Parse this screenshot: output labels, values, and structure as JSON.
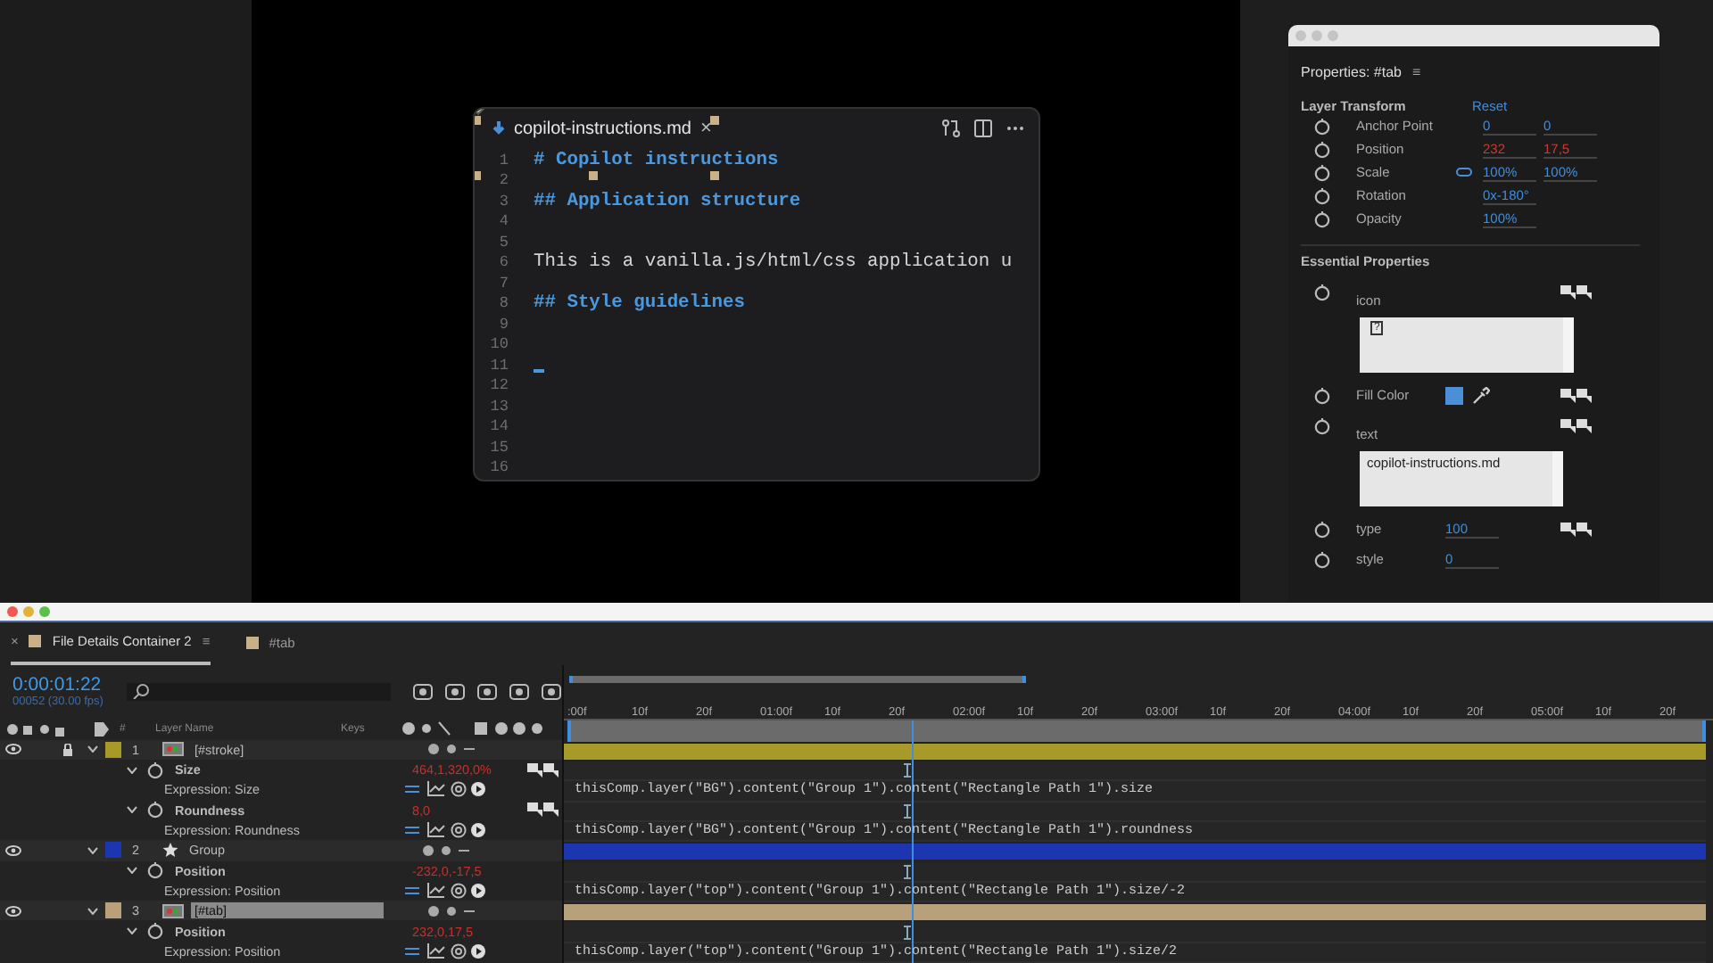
{
  "editor": {
    "tab_title": "copilot-instructions.md",
    "close": "×",
    "lines": [
      {
        "number": "1",
        "text": "# Copilot instructions",
        "kind": "heading"
      },
      {
        "number": "2",
        "kind": "empty"
      },
      {
        "number": "3",
        "text": "## Application structure",
        "kind": "heading"
      },
      {
        "number": "4",
        "kind": "empty"
      },
      {
        "number": "5",
        "kind": "empty"
      },
      {
        "number": "6",
        "text": "This is a vanilla.js/html/css application u",
        "kind": "plain"
      },
      {
        "number": "7",
        "kind": "empty"
      },
      {
        "number": "8",
        "text": "## Style guidelines",
        "kind": "heading"
      },
      {
        "number": "9",
        "kind": "empty"
      },
      {
        "number": "10",
        "kind": "empty"
      },
      {
        "number": "11",
        "kind": "cursor"
      },
      {
        "number": "12",
        "kind": "empty"
      },
      {
        "number": "13",
        "kind": "empty"
      },
      {
        "number": "14",
        "kind": "empty"
      },
      {
        "number": "15",
        "kind": "empty"
      },
      {
        "number": "16",
        "kind": "empty"
      }
    ]
  },
  "properties": {
    "title": "Properties: #tab",
    "menu": "≡",
    "transform_heading": "Layer Transform",
    "reset": "Reset",
    "transform_rows": [
      {
        "label": "Anchor Point",
        "linked": false,
        "values": [
          {
            "text": "0",
            "changed": false
          },
          {
            "text": "0",
            "changed": false
          }
        ]
      },
      {
        "label": "Position",
        "linked": false,
        "values": [
          {
            "text": "232",
            "changed": true
          },
          {
            "text": "17,5",
            "changed": true
          }
        ]
      },
      {
        "label": "Scale",
        "linked": true,
        "values": [
          {
            "text": "100%",
            "changed": false
          },
          {
            "text": "100%",
            "changed": false
          }
        ]
      },
      {
        "label": "Rotation",
        "linked": false,
        "values": [
          {
            "text": "0x-180°",
            "changed": false
          }
        ]
      },
      {
        "label": "Opacity",
        "linked": false,
        "values": [
          {
            "text": "100%",
            "changed": false
          }
        ]
      }
    ],
    "essential_heading": "Essential Properties",
    "essential": [
      {
        "kind": "image",
        "label": "icon",
        "value": "?"
      },
      {
        "kind": "color",
        "label": "Fill Color",
        "color": "#4a8fd8"
      },
      {
        "kind": "text",
        "label": "text",
        "value": "copilot-instructions.md"
      },
      {
        "kind": "number",
        "label": "type",
        "value": "100"
      },
      {
        "kind": "number",
        "label": "style",
        "value": "0"
      }
    ]
  },
  "timeline": {
    "tabs": [
      {
        "label": "File Details Container 2",
        "selected": true,
        "close": "×",
        "menu": "≡"
      },
      {
        "label": "#tab",
        "selected": false
      }
    ],
    "timecode": "0:00:01:22",
    "frame_info": "00052 (30.00 fps)",
    "columns": {
      "number": "#",
      "name": "Layer Name",
      "keys": "Keys"
    },
    "ruler": [
      ":00f",
      "10f",
      "20f",
      "01:00f",
      "10f",
      "20f",
      "02:00f",
      "10f",
      "20f",
      "03:00f",
      "10f",
      "20f",
      "04:00f",
      "10f",
      "20f",
      "05:00f",
      "10f",
      "20f"
    ],
    "work_area": {
      "level": 0.4
    },
    "playhead": {
      "level": 0.3
    },
    "rows": [
      {
        "kind": "footage_layer",
        "number": "1",
        "name": "[#stroke]",
        "color": "#a89a28",
        "selected": false
      },
      {
        "kind": "property",
        "name": "Size",
        "value": "464,1,320,0%"
      },
      {
        "kind": "expression",
        "name": "Expression: Size",
        "expression": "thisComp.layer(\"BG\").content(\"Group 1\").content(\"Rectangle Path 1\").size"
      },
      {
        "kind": "property",
        "name": "Roundness",
        "value": "8,0"
      },
      {
        "kind": "expression",
        "name": "Expression: Roundness",
        "expression": "thisComp.layer(\"BG\").content(\"Group 1\").content(\"Rectangle Path 1\").roundness"
      },
      {
        "kind": "shape_layer",
        "number": "2",
        "name": "Group",
        "color": "#1c35b0",
        "selected": false
      },
      {
        "kind": "property",
        "name": "Position",
        "value": "-232,0,-17,5"
      },
      {
        "kind": "expression",
        "name": "Expression: Position",
        "expression": "thisComp.layer(\"top\").content(\"Group 1\").content(\"Rectangle Path 1\").size/-2"
      },
      {
        "kind": "footage_layer",
        "number": "3",
        "name": "[#tab]",
        "color": "#b8a07a",
        "selected": true
      },
      {
        "kind": "property",
        "name": "Position",
        "value": "232,0,17,5"
      },
      {
        "kind": "expression",
        "name": "Expression: Position",
        "expression": "thisComp.layer(\"top\").content(\"Group 1\").content(\"Rectangle Path 1\").size/2"
      }
    ]
  }
}
